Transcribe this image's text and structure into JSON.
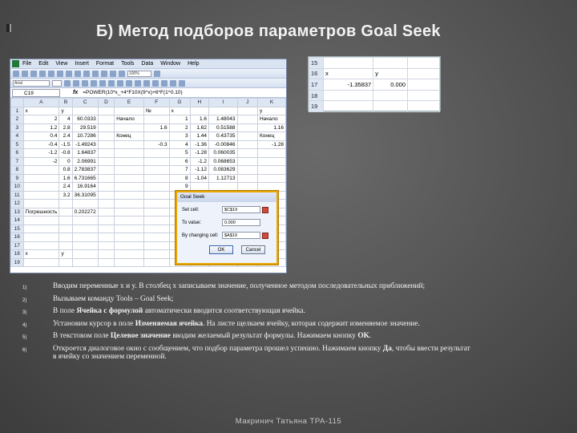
{
  "slide": {
    "title": "Б) Метод подборов параметров Goal Seek",
    "footer": "Макринич Татьяна   ТРА-115"
  },
  "excel": {
    "menu": [
      "File",
      "Edit",
      "View",
      "Insert",
      "Format",
      "Tools",
      "Data",
      "Window",
      "Help"
    ],
    "font_box": "Arial",
    "zoom_box": "100%",
    "name_box": "C19",
    "fx": "fx",
    "formula": "=POWER(10*x_+4*F10X(9^x)+6*F(1^0.10)",
    "columns": [
      "A",
      "B",
      "C",
      "D",
      "E",
      "F",
      "G",
      "H",
      "I",
      "J",
      "K"
    ],
    "rows": [
      {
        "n": "1",
        "cells": [
          "x",
          "y",
          "",
          "",
          "",
          "№",
          "x",
          "",
          "",
          "",
          "y"
        ]
      },
      {
        "n": "2",
        "cells": [
          "2",
          "4",
          "60.0333",
          "",
          "Начало",
          "",
          "1",
          "1.6",
          "1.48043",
          "",
          "Начало"
        ]
      },
      {
        "n": "3",
        "cells": [
          "1.2",
          "2.8",
          "29.519",
          "",
          "",
          "1.6",
          "2",
          "1.62",
          "0.51588",
          "",
          "1.16"
        ]
      },
      {
        "n": "4",
        "cells": [
          "0.4",
          "2.4",
          "10.7286",
          "",
          "Конец",
          "",
          "3",
          "1.44",
          "0.43735",
          "",
          "Конец"
        ]
      },
      {
        "n": "5",
        "cells": [
          "-0.4",
          "-1.5",
          "-1.49243",
          "",
          "",
          "-0.3",
          "4",
          "-1.36",
          "-0.00846",
          "",
          "-1.28"
        ]
      },
      {
        "n": "6",
        "cells": [
          "-1.2",
          "-0.8",
          "1.64837",
          "",
          "",
          "",
          "5",
          "-1.28",
          "0.060035",
          "",
          ""
        ]
      },
      {
        "n": "7",
        "cells": [
          "-2",
          "0",
          "2.06991",
          "",
          "",
          "",
          "6",
          "-1.2",
          "0.068653",
          "",
          ""
        ]
      },
      {
        "n": "8",
        "cells": [
          "",
          "0.8",
          "2.783837",
          "",
          "",
          "",
          "7",
          "-1.12",
          "0.083629",
          "",
          ""
        ]
      },
      {
        "n": "9",
        "cells": [
          "",
          "1.6",
          "6.731665",
          "",
          "",
          "",
          "8",
          "-1.04",
          "1.12713",
          "",
          ""
        ]
      },
      {
        "n": "10",
        "cells": [
          "",
          "2.4",
          "16.9164",
          "",
          "",
          "",
          "9",
          "",
          "",
          "",
          ""
        ]
      },
      {
        "n": "11",
        "cells": [
          "",
          "3.2",
          "36.31095",
          "",
          "",
          "",
          "10",
          "",
          "",
          "",
          ""
        ]
      },
      {
        "n": "12",
        "cells": [
          "",
          "",
          "",
          "",
          "",
          "",
          "",
          "",
          "",
          "",
          ""
        ]
      },
      {
        "n": "13",
        "cells": [
          "Погрешность",
          "",
          "0.202272",
          "",
          "",
          "",
          "",
          "По",
          "",
          "",
          ""
        ]
      },
      {
        "n": "14",
        "cells": [
          "",
          "",
          "",
          "",
          "",
          "",
          "",
          "",
          "",
          "",
          ""
        ]
      },
      {
        "n": "15",
        "cells": [
          "",
          "",
          "",
          "",
          "",
          "",
          "",
          "",
          "",
          "",
          ""
        ]
      },
      {
        "n": "16",
        "cells": [
          "",
          "",
          "",
          "",
          "",
          "",
          "",
          "",
          "",
          "",
          ""
        ]
      },
      {
        "n": "17",
        "cells": [
          "",
          "",
          "",
          "",
          "",
          "",
          "",
          "",
          "",
          "",
          ""
        ]
      },
      {
        "n": "18",
        "cells": [
          "x",
          "y",
          "",
          "",
          "",
          "",
          "",
          "",
          "",
          "",
          ""
        ]
      },
      {
        "n": "19",
        "cells": [
          "",
          "",
          "",
          "",
          "",
          "",
          "",
          "",
          "",
          "",
          ""
        ]
      }
    ]
  },
  "goal_seek": {
    "title": "Goal Seek",
    "set_cell_label": "Set cell:",
    "set_cell_value": "$C$19",
    "to_value_label": "To value:",
    "to_value_value": "0.000",
    "by_changing_label": "By changing cell:",
    "by_changing_value": "$A$19",
    "ok": "OK",
    "cancel": "Cancel"
  },
  "mini_sheet": {
    "rows": [
      {
        "n": "15",
        "a": "",
        "b": ""
      },
      {
        "n": "16",
        "a": "x",
        "b": "y"
      },
      {
        "n": "17",
        "a": "-1.35837",
        "b": "0.000"
      },
      {
        "n": "18",
        "a": "",
        "b": ""
      },
      {
        "n": "19",
        "a": "",
        "b": ""
      }
    ]
  },
  "steps": [
    {
      "n": "1)",
      "text": "Вводим переменные x и y. В столбец x записываем значение, полученное методом последовательных приближений;"
    },
    {
      "n": "2)",
      "text": "Вызываем команду Tools – Goal Seek;"
    },
    {
      "n": "3)",
      "pre": "В поле ",
      "bold": "Ячейка с формулой",
      "post": " автоматически вводится соответствующая ячейка."
    },
    {
      "n": "4)",
      "pre": "Установим курсор в поле ",
      "bold": "Изменяемая ячейка",
      "post": ". На листе щелкаем ячейку, которая содержит изменяемое значение."
    },
    {
      "n": "5)",
      "pre": "В текстовом поле ",
      "bold": "Целевое значение",
      "post": " вводим желаемый результат формулы. Нажимаем кнопку ",
      "bold2": "OK",
      "post2": "."
    },
    {
      "n": "6)",
      "pre": "Откроется диалоговое окно с сообщением, что подбор параметра прошел успешно. Нажимаем кнопку ",
      "bold": "Да",
      "post": ", чтобы ввести результат в ячейку со значением переменной."
    }
  ]
}
